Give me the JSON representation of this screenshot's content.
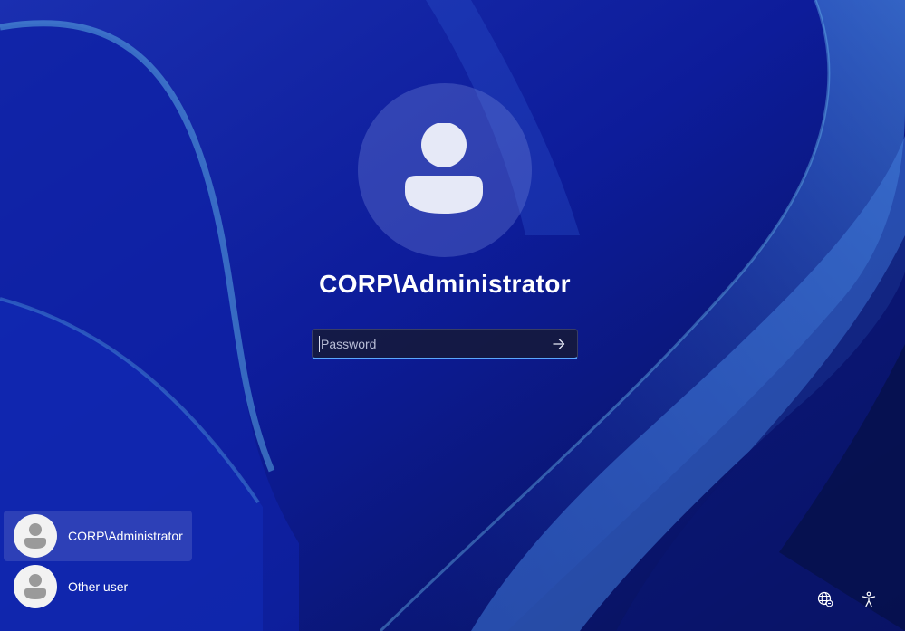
{
  "login": {
    "username_title": "CORP\\Administrator",
    "avatar_icon": "user-silhouette-icon",
    "password": {
      "value": "",
      "placeholder": "Password",
      "submit_icon": "arrow-right-icon"
    }
  },
  "user_list": [
    {
      "label": "CORP\\Administrator",
      "selected": true,
      "icon": "user-silhouette-icon"
    },
    {
      "label": "Other user",
      "selected": false,
      "icon": "user-silhouette-icon"
    }
  ],
  "corner_buttons": [
    {
      "icon": "network-globe-icon"
    },
    {
      "icon": "accessibility-icon"
    }
  ],
  "colors": {
    "wallpaper_base": "#0a1a8a",
    "input_focus": "#5aa6ff",
    "avatar_fill": "#e6e9f7"
  }
}
